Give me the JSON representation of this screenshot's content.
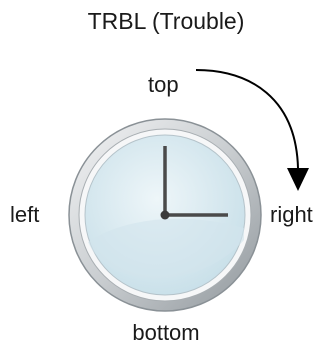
{
  "title": "TRBL (Trouble)",
  "labels": {
    "top": "top",
    "right": "right",
    "bottom": "bottom",
    "left": "left"
  },
  "icons": {
    "clock": "wall-clock-icon",
    "arrow": "clockwise-arrow-icon"
  },
  "colors": {
    "text": "#1a1a1a",
    "clock_face": "#d6e8ef",
    "clock_rim": "#9aa1a6",
    "hands": "#4a4a4a"
  }
}
